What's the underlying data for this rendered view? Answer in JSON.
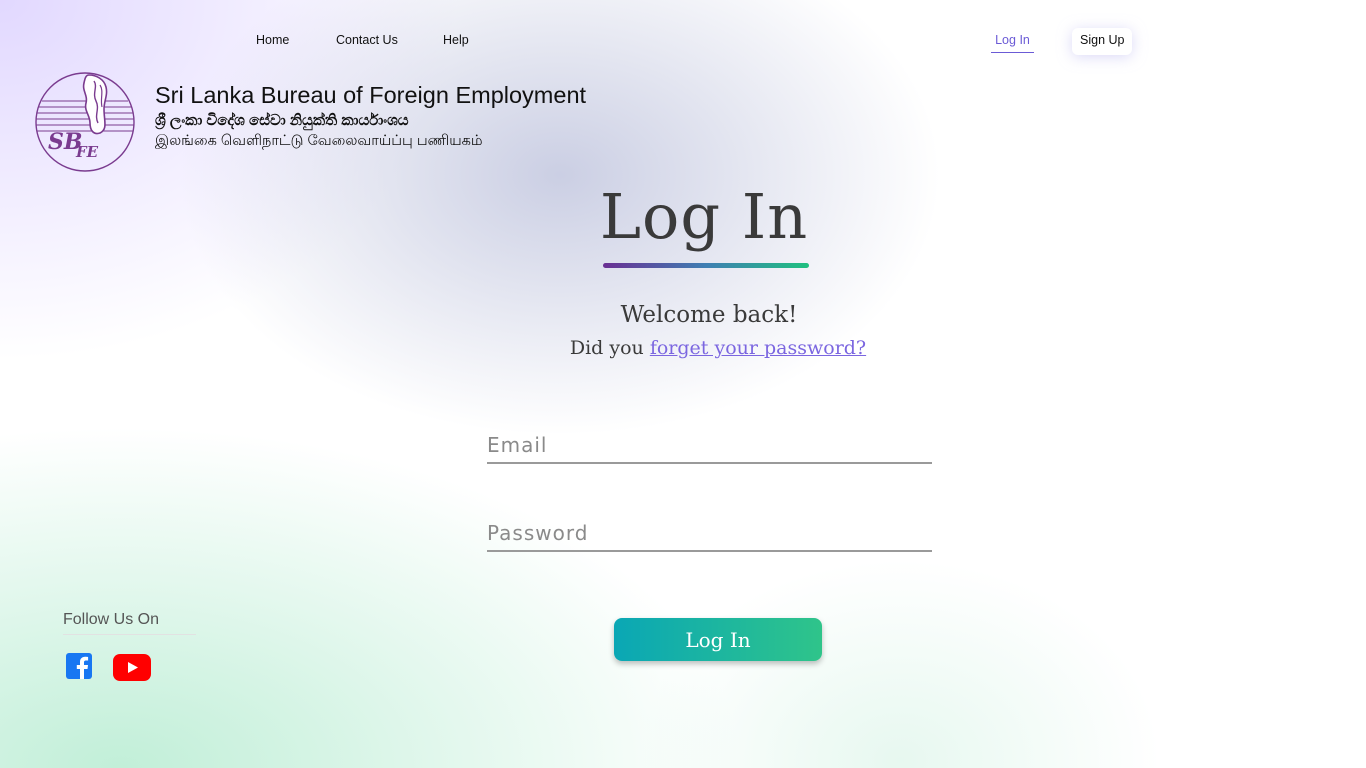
{
  "nav": {
    "home": "Home",
    "contact": "Contact Us",
    "help": "Help",
    "login": "Log In",
    "signup": "Sign Up"
  },
  "brand": {
    "name_en": "Sri Lanka Bureau of Foreign Employment",
    "name_si": "ශ්‍රී ලංකා විදේශ සේවා නියුක්ති කාර්යාංශය",
    "name_ta": "இலங்கை வெளிநாட்டு வேலைவாய்ப்பு பணியகம்",
    "logo_text": "SLBFE"
  },
  "main": {
    "title": "Log In",
    "welcome": "Welcome back!",
    "forgot_prefix": "Did you ",
    "forgot_link": "forget your password?",
    "email_placeholder": "Email",
    "email_value": "",
    "password_placeholder": "Password",
    "password_value": "",
    "submit_label": "Log In"
  },
  "social": {
    "heading": "Follow Us On",
    "icons": [
      "facebook-icon",
      "youtube-icon"
    ]
  },
  "colors": {
    "accent": "#6b5bd6",
    "link": "#7b66e0",
    "button_start": "#0aa7b5",
    "button_end": "#2fc48a",
    "facebook": "#1877f2",
    "youtube": "#ff0000",
    "logo_purple": "#7a3b8f"
  }
}
